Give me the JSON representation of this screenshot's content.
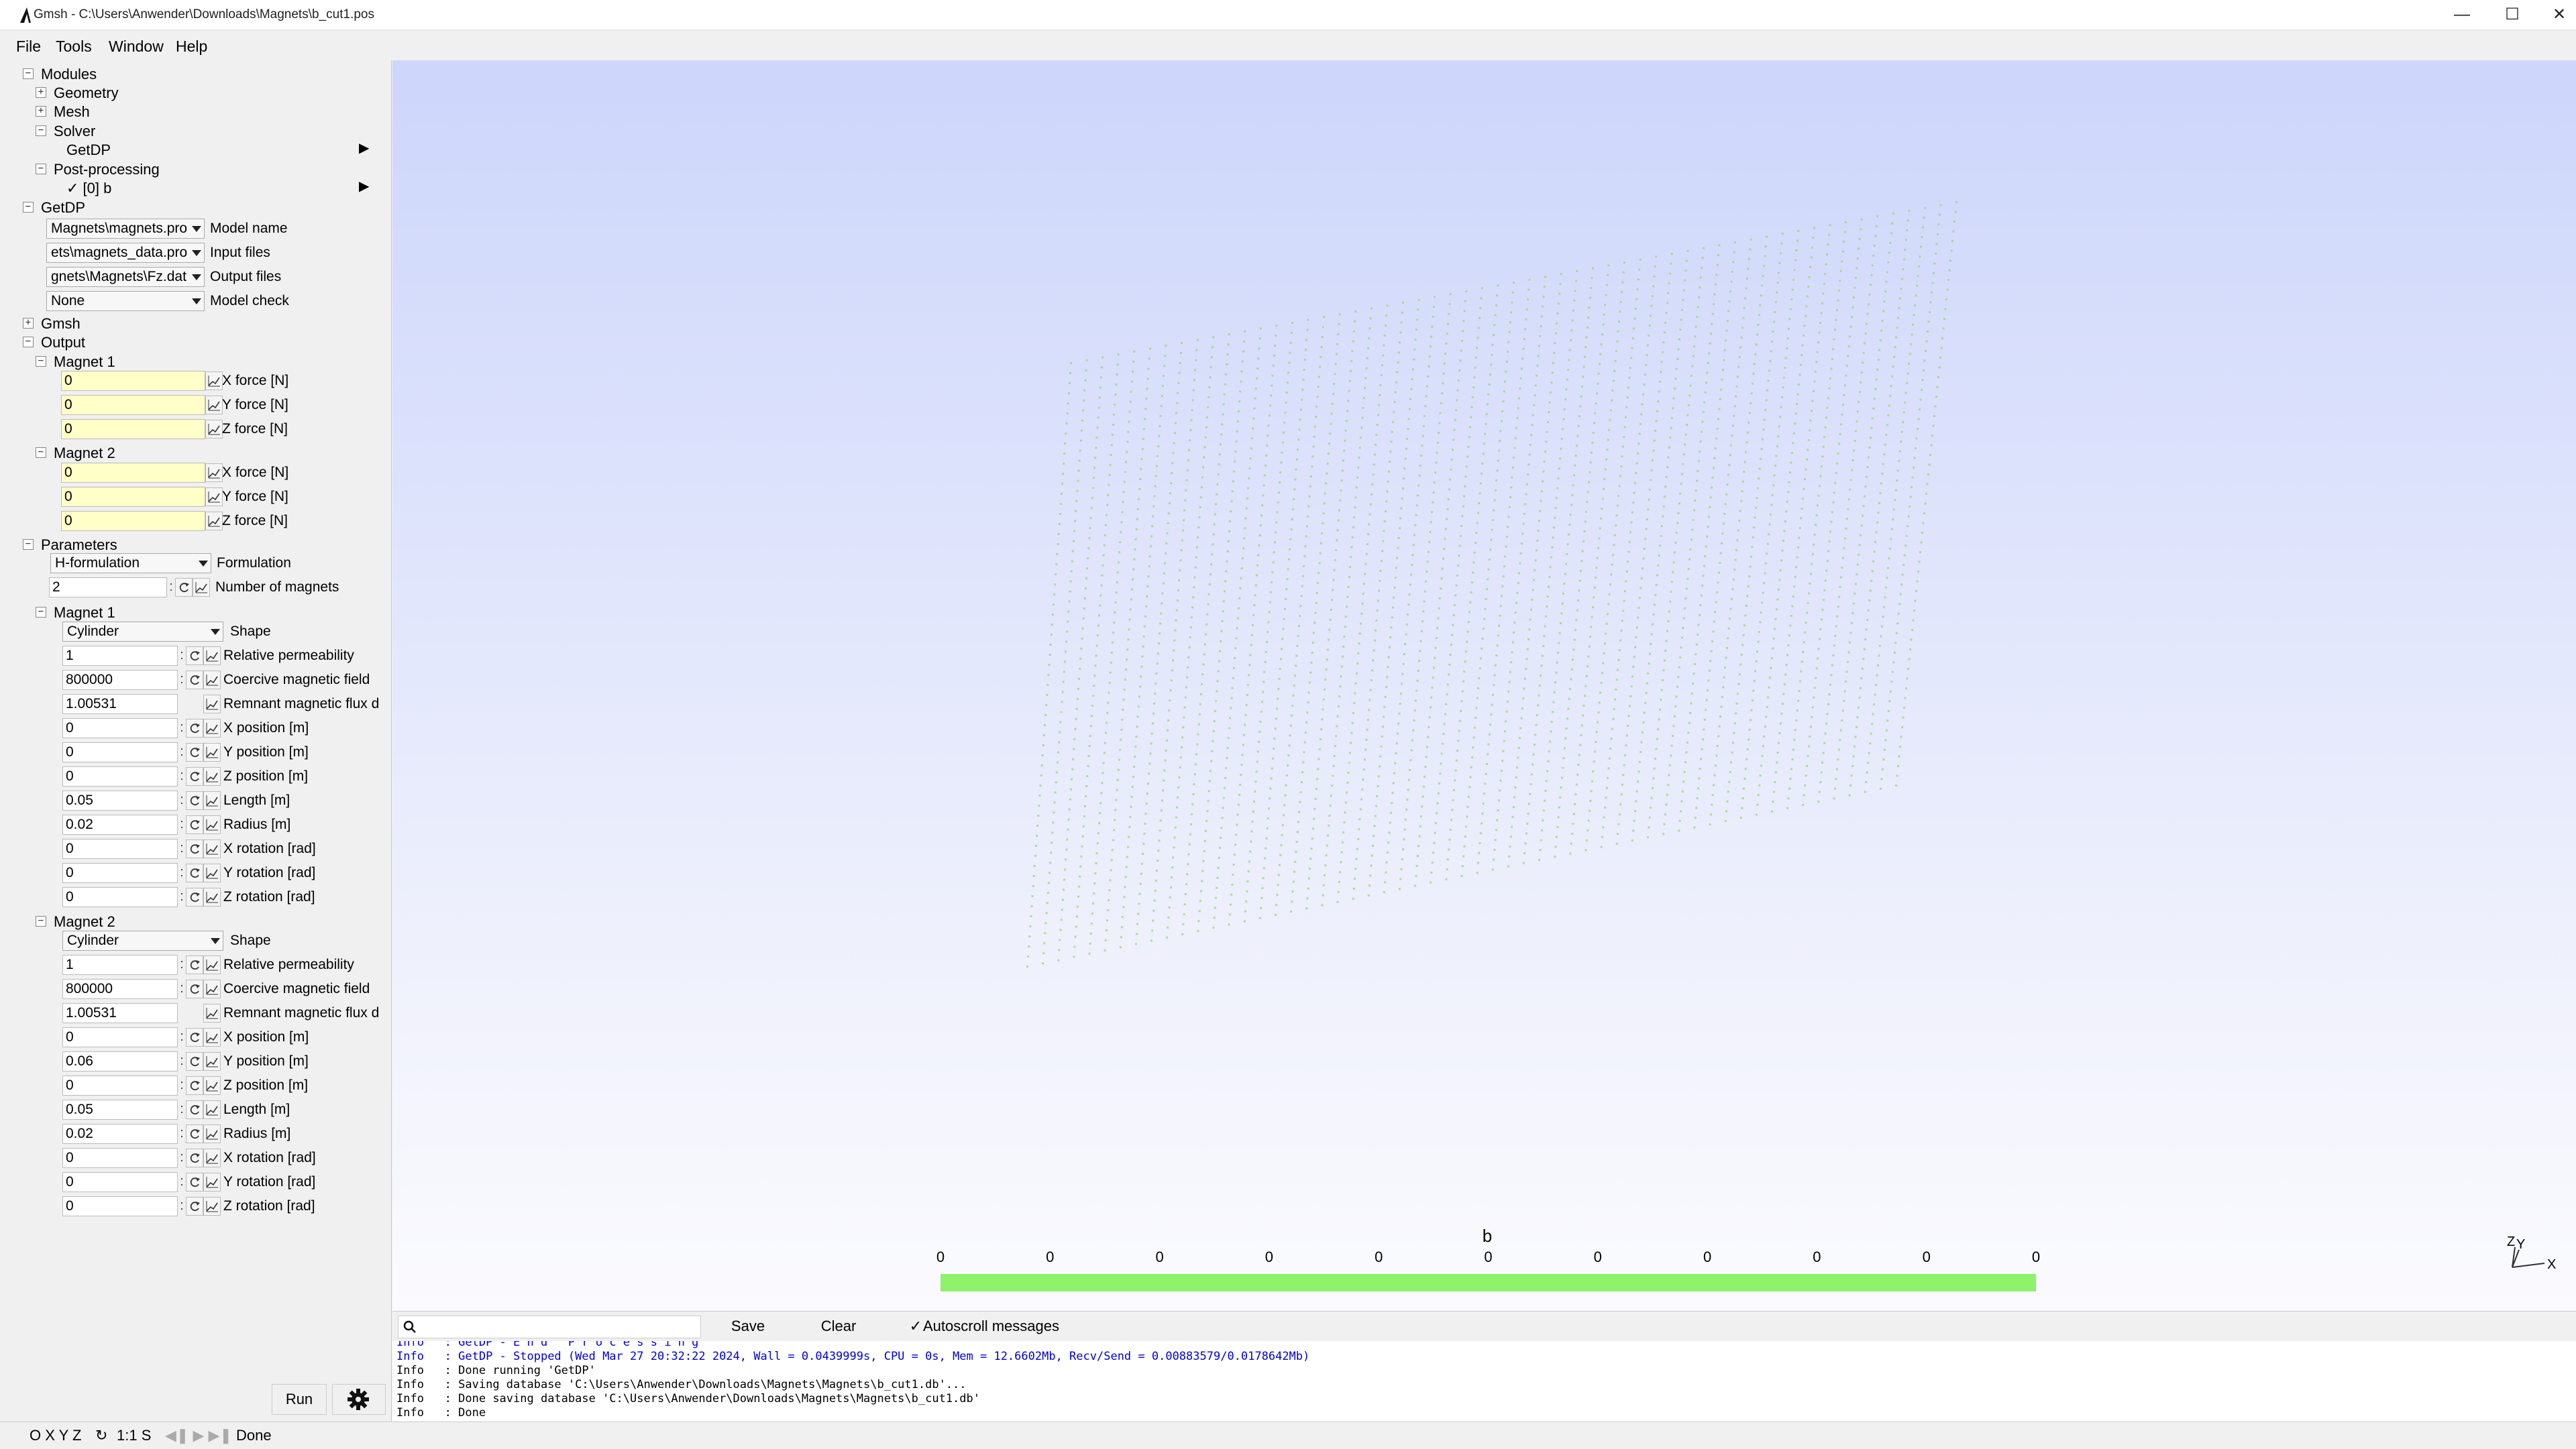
{
  "window": {
    "title": "Gmsh - C:\\Users\\Anwender\\Downloads\\Magnets\\b_cut1.pos"
  },
  "menu": {
    "file": "File",
    "tools": "Tools",
    "window": "Window",
    "help": "Help"
  },
  "tree": {
    "modules": "Modules",
    "geometry": "Geometry",
    "mesh": "Mesh",
    "solver": "Solver",
    "solver_getdp": "GetDP",
    "postprocessing": "Post-processing",
    "view0": "✓ [0] b",
    "getdp": "GetDP",
    "getdp_fields": [
      {
        "value": "Magnets\\magnets.pro",
        "label": "Model name"
      },
      {
        "value": "ets\\magnets_data.pro",
        "label": "Input files"
      },
      {
        "value": "gnets\\Magnets\\Fz.dat",
        "label": "Output files"
      },
      {
        "value": "None",
        "label": "Model check"
      }
    ],
    "gmsh": "Gmsh",
    "output": "Output",
    "output_magnet1": "Magnet 1",
    "output_magnet2": "Magnet 2",
    "forces1": [
      {
        "value": "0",
        "label": "X force [N]"
      },
      {
        "value": "0",
        "label": "Y force [N]"
      },
      {
        "value": "0",
        "label": "Z force [N]"
      }
    ],
    "forces2": [
      {
        "value": "0",
        "label": "X force [N]"
      },
      {
        "value": "0",
        "label": "Y force [N]"
      },
      {
        "value": "0",
        "label": "Z force [N]"
      }
    ],
    "parameters": "Parameters",
    "formulation": {
      "value": "H-formulation",
      "label": "Formulation"
    },
    "nmagnets": {
      "value": "2",
      "label": "Number of magnets"
    },
    "param_magnet1": "Magnet 1",
    "param_magnet2": "Magnet 2",
    "shape1": {
      "value": "Cylinder",
      "label": "Shape"
    },
    "shape2": {
      "value": "Cylinder",
      "label": "Shape"
    },
    "params1": [
      {
        "value": "1",
        "label": "Relative permeability"
      },
      {
        "value": "800000",
        "label": "Coercive magnetic field"
      },
      {
        "value": "1.00531",
        "label": "Remnant magnetic flux d"
      },
      {
        "value": "0",
        "label": "X position [m]"
      },
      {
        "value": "0",
        "label": "Y position [m]"
      },
      {
        "value": "0",
        "label": "Z position [m]"
      },
      {
        "value": "0.05",
        "label": "Length [m]"
      },
      {
        "value": "0.02",
        "label": "Radius [m]"
      },
      {
        "value": "0",
        "label": "X rotation [rad]"
      },
      {
        "value": "0",
        "label": "Y rotation [rad]"
      },
      {
        "value": "0",
        "label": "Z rotation [rad]"
      }
    ],
    "params2": [
      {
        "value": "1",
        "label": "Relative permeability"
      },
      {
        "value": "800000",
        "label": "Coercive magnetic field"
      },
      {
        "value": "1.00531",
        "label": "Remnant magnetic flux d"
      },
      {
        "value": "0",
        "label": "X position [m]"
      },
      {
        "value": "0.06",
        "label": "Y position [m]"
      },
      {
        "value": "0",
        "label": "Z position [m]"
      },
      {
        "value": "0.05",
        "label": "Length [m]"
      },
      {
        "value": "0.02",
        "label": "Radius [m]"
      },
      {
        "value": "0",
        "label": "X rotation [rad]"
      },
      {
        "value": "0",
        "label": "Y rotation [rad]"
      },
      {
        "value": "0",
        "label": "Z rotation [rad]"
      }
    ]
  },
  "buttons": {
    "run": "Run"
  },
  "viewport": {
    "scale_title": "b",
    "scale_ticks": [
      "0",
      "0",
      "0",
      "0",
      "0",
      "0",
      "0",
      "0",
      "0",
      "0",
      "0"
    ],
    "axis_labels": {
      "z": "Z",
      "y": "Y",
      "x": "X"
    },
    "point_color": "#9bd56a",
    "scale_color": "#8ef26a"
  },
  "messages": {
    "search_placeholder": "",
    "save": "Save",
    "clear": "Clear",
    "autoscroll": "Autoscroll messages",
    "lines": [
      {
        "tag": "Info",
        "text": ": GetDP - E n d   P r o c e s s i n g",
        "blue": true
      },
      {
        "tag": "Info",
        "text": ": GetDP - Stopped (Wed Mar 27 20:32:22 2024, Wall = 0.0439999s, CPU = 0s, Mem = 12.6602Mb, Recv/Send = 0.00883579/0.0178642Mb)",
        "blue": true
      },
      {
        "tag": "Info",
        "text": ": Done running 'GetDP'",
        "blue": false
      },
      {
        "tag": "Info",
        "text": ": Saving database 'C:\\Users\\Anwender\\Downloads\\Magnets\\Magnets\\b_cut1.db'...",
        "blue": false
      },
      {
        "tag": "Info",
        "text": ": Done saving database 'C:\\Users\\Anwender\\Downloads\\Magnets\\Magnets\\b_cut1.db'",
        "blue": false
      },
      {
        "tag": "Info",
        "text": ": Done",
        "blue": false
      }
    ]
  },
  "status": {
    "axes": "O X Y Z",
    "scale": "1:1 S",
    "text": "Done"
  }
}
